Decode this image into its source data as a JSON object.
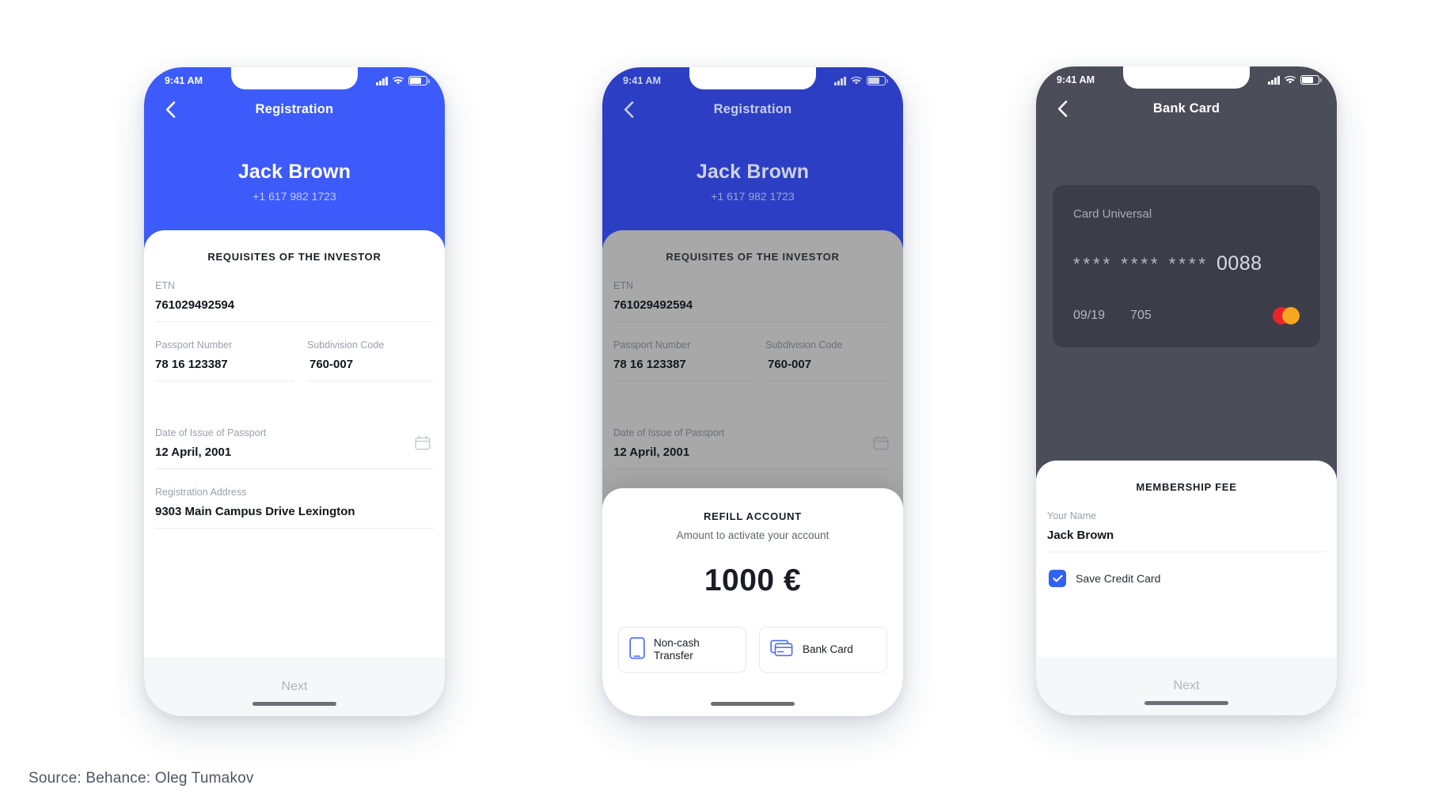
{
  "caption": "Source: Behance: Oleg Tumakov",
  "status_bar": {
    "time": "9:41 AM",
    "signal_icon": "signal-bars-icon",
    "wifi_icon": "wifi-icon",
    "battery_icon": "battery-icon"
  },
  "phone1": {
    "nav": {
      "title": "Registration",
      "back_icon": "chevron-left-icon"
    },
    "hero": {
      "name": "Jack Brown",
      "phone": "+1 617 982 1723"
    },
    "sheet_title": "REQUISITES OF THE INVESTOR",
    "fields": [
      {
        "label": "ETN",
        "value": "761029492594"
      },
      {
        "label": "Passport Number",
        "value": "78 16 123387"
      },
      {
        "label": "Subdivision Code",
        "value": "760-007"
      },
      {
        "label": "Date of Issue of Passport",
        "value": "12 April, 2001",
        "icon": "calendar-icon"
      },
      {
        "label": "Registration Address",
        "value": "9303 Main Campus Drive Lexington"
      }
    ],
    "cta": "Next"
  },
  "phone2": {
    "nav": {
      "title": "Registration",
      "back_icon": "chevron-left-icon"
    },
    "hero": {
      "name": "Jack Brown",
      "phone": "+1 617 982 1723"
    },
    "sheet_title": "REQUISITES OF THE INVESTOR",
    "fields": [
      {
        "label": "ETN",
        "value": "761029492594"
      },
      {
        "label": "Passport Number",
        "value": "78 16 123387"
      },
      {
        "label": "Subdivision Code",
        "value": "760-007"
      },
      {
        "label": "Date of Issue of Passport",
        "value": "12 April, 2001",
        "icon": "calendar-icon"
      }
    ],
    "modal": {
      "title": "REFILL ACCOUNT",
      "subtitle": "Amount to activate your account",
      "amount": "1000 €",
      "options": [
        {
          "label_line1": "Non-cash",
          "label_line2": "Transfer",
          "icon": "mobile-phone-icon"
        },
        {
          "label_line1": "Bank Card",
          "label_line2": "",
          "icon": "credit-cards-icon"
        }
      ]
    }
  },
  "phone3": {
    "nav": {
      "title": "Bank Card",
      "back_icon": "chevron-left-icon"
    },
    "card": {
      "name": "Card Universal",
      "masked": "**** **** ****",
      "last4": "0088",
      "expiry": "09/19",
      "cvv": "705",
      "brand_icon": "mastercard-icon"
    },
    "sheet_title": "MEMBERSHIP FEE",
    "fields": [
      {
        "label": "Your Name",
        "value": "Jack Brown"
      }
    ],
    "checkbox": {
      "label": "Save Credit Card",
      "checked": true,
      "icon": "checkmark-icon"
    },
    "cta": "Next"
  },
  "colors": {
    "blue": "#3c5bfa",
    "blue_dim": "#2c3fc4",
    "dark": "#4b4d59",
    "card": "#3b3d49",
    "accent_check": "#2f62f5",
    "mastercard_red": "#e8242a",
    "mastercard_yellow": "#f5a623"
  }
}
